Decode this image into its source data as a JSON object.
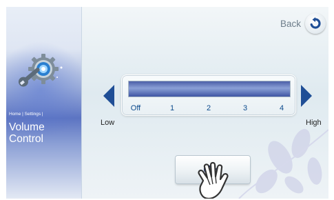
{
  "breadcrumb": "Home | Settings |",
  "page_title_line1": "Volume",
  "page_title_line2": "Control",
  "back_label": "Back",
  "volume": {
    "ticks": [
      "Off",
      "1",
      "2",
      "3",
      "4"
    ],
    "low_label": "Low",
    "high_label": "High",
    "level_fraction": 1.0
  },
  "ok_label": "OK",
  "colors": {
    "accent": "#1f4e96",
    "fill": "#4c5fa8",
    "tick_text": "#0b4a8c"
  },
  "icons": [
    "gear-wrench-icon",
    "back-arrow-icon",
    "arrow-left-icon",
    "arrow-right-icon",
    "hand-pointer-icon"
  ]
}
